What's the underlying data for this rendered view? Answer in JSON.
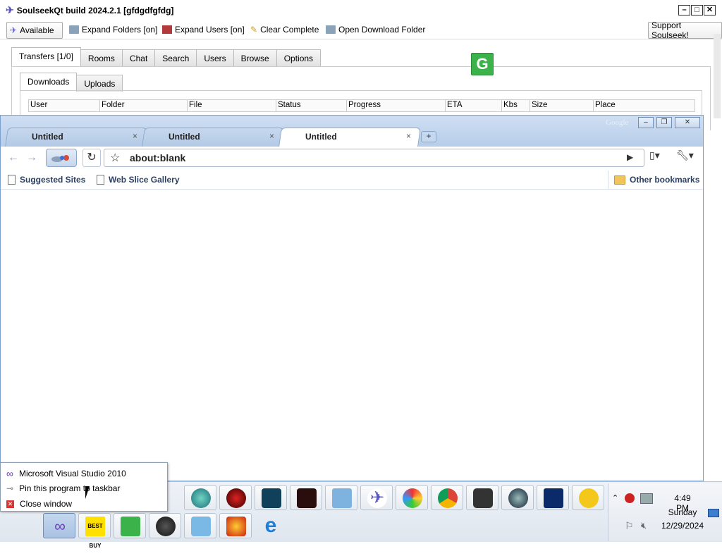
{
  "soulseek": {
    "title": "SoulseekQt build 2024.2.1 [gfdgdfgfdg]",
    "toolbar": {
      "available": "Available",
      "expand_folders": "Expand Folders [on]",
      "expand_users": "Expand Users [on]",
      "clear_complete": "Clear Complete",
      "open_download_folder": "Open Download Folder",
      "support": "Support Soulseek!"
    },
    "tabs": [
      "Transfers [1/0]",
      "Rooms",
      "Chat",
      "Search",
      "Users",
      "Browse",
      "Options"
    ],
    "subtabs": [
      "Downloads",
      "Uploads"
    ],
    "columns": [
      "User",
      "Folder",
      "File",
      "Status",
      "Progress",
      "ETA",
      "Kbs",
      "Size",
      "Place"
    ]
  },
  "browser": {
    "tabs": [
      "Untitled",
      "Untitled",
      "Untitled"
    ],
    "active_tab": 2,
    "address": "about:blank",
    "bookmarks": [
      "Suggested Sites",
      "Web Slice Gallery"
    ],
    "other_bookmarks": "Other bookmarks",
    "corner_mark": "Google"
  },
  "jumplist": {
    "items": [
      "Microsoft Visual Studio 2010",
      "Pin this program to taskbar",
      "Close window"
    ]
  },
  "taskbar": {
    "row1": [
      "steam",
      "gamecenter",
      "shield",
      "video-rec",
      "remote-desktop",
      "soulseek",
      "paint",
      "chrome",
      "tiles",
      "orb",
      "starburst",
      "gopher"
    ],
    "row2": [
      "visual-studio",
      "bestbuy",
      "greenshot",
      "blackberry",
      "security",
      "firefox-flame",
      "ie"
    ],
    "bestbuy_label": "BEST BUY"
  },
  "clock": {
    "time": "4:49 PM",
    "day": "Sunday",
    "date": "12/29/2024"
  },
  "colors": {
    "browser_frame": "#b6cde9",
    "taskbar": "#dfe6ef",
    "accent": "#3bb24a"
  }
}
